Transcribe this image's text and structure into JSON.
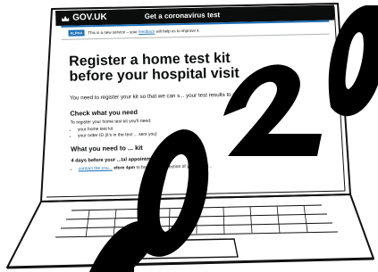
{
  "header": {
    "logo_text": "GOV.UK",
    "service_name": "Get a coronavirus test"
  },
  "phase_banner": {
    "tag": "ALPHA",
    "text_before": "This is a new service – your",
    "link": "feedback",
    "text_after": "will help us to improve it."
  },
  "main": {
    "title": "Register a home test kit before your hospital visit",
    "lead": "You need to register your kit so that we can s... your test results to you.",
    "section1": {
      "heading": "Check what you need",
      "intro": "To register your home test kit you'll need:",
      "items": [
        "your home test kit",
        "your order ID (it's in the text ... sent you)"
      ]
    },
    "section2": {
      "heading": "What you need to ... kit",
      "subheading": "4 days before your ...tal appointment:",
      "item_link": "contact the cou...",
      "item_bold": "efore 4pm",
      "item_rest": "to book ne... collection of your test ki..."
    }
  },
  "colors": {
    "header_bg": "#0b0c0c",
    "gov_blue": "#1d70b8",
    "ink": "#0b0c0c"
  },
  "overlay": {
    "text": "2020",
    "color": "#000000"
  }
}
